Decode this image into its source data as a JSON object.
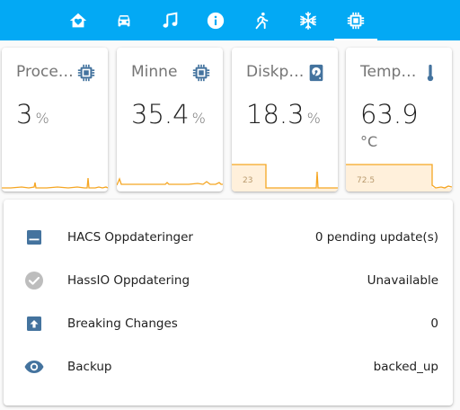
{
  "colors": {
    "toolbar": "#03a9f4",
    "card": "#ffffff",
    "icon_blue": "#44739e",
    "spark_line": "#f5a623",
    "spark_fill": "#fff0db"
  },
  "tabs": [
    {
      "icon": "home-heart-icon",
      "active": false
    },
    {
      "icon": "car-icon",
      "active": false
    },
    {
      "icon": "music-note-icon",
      "active": false
    },
    {
      "icon": "information-icon",
      "active": false
    },
    {
      "icon": "run-icon",
      "active": false
    },
    {
      "icon": "snowflake-icon",
      "active": false
    },
    {
      "icon": "chip-icon",
      "active": true
    }
  ],
  "sensors": [
    {
      "name": "Processor",
      "value": "3",
      "unit": "%",
      "icon": "chip-icon",
      "graph_label": ""
    },
    {
      "name": "Minne",
      "value": "35.4",
      "unit": "%",
      "icon": "chip-icon",
      "graph_label": ""
    },
    {
      "name": "Diskplass",
      "value": "18.3",
      "unit": "%",
      "icon": "harddisk-icon",
      "graph_label": "23"
    },
    {
      "name": "Temp CPU",
      "value": "63.9",
      "unit": "°C",
      "icon": "thermometer-icon",
      "graph_label": "72.5"
    }
  ],
  "entities": [
    {
      "name": "HACS Oppdateringer",
      "state": "0 pending update(s)",
      "icon": "package-icon"
    },
    {
      "name": "HassIO Oppdatering",
      "state": "Unavailable",
      "icon": "check-circle-icon"
    },
    {
      "name": "Breaking Changes",
      "state": "0",
      "icon": "package-up-icon"
    },
    {
      "name": "Backup",
      "state": "backed_up",
      "icon": "eye-icon"
    }
  ]
}
